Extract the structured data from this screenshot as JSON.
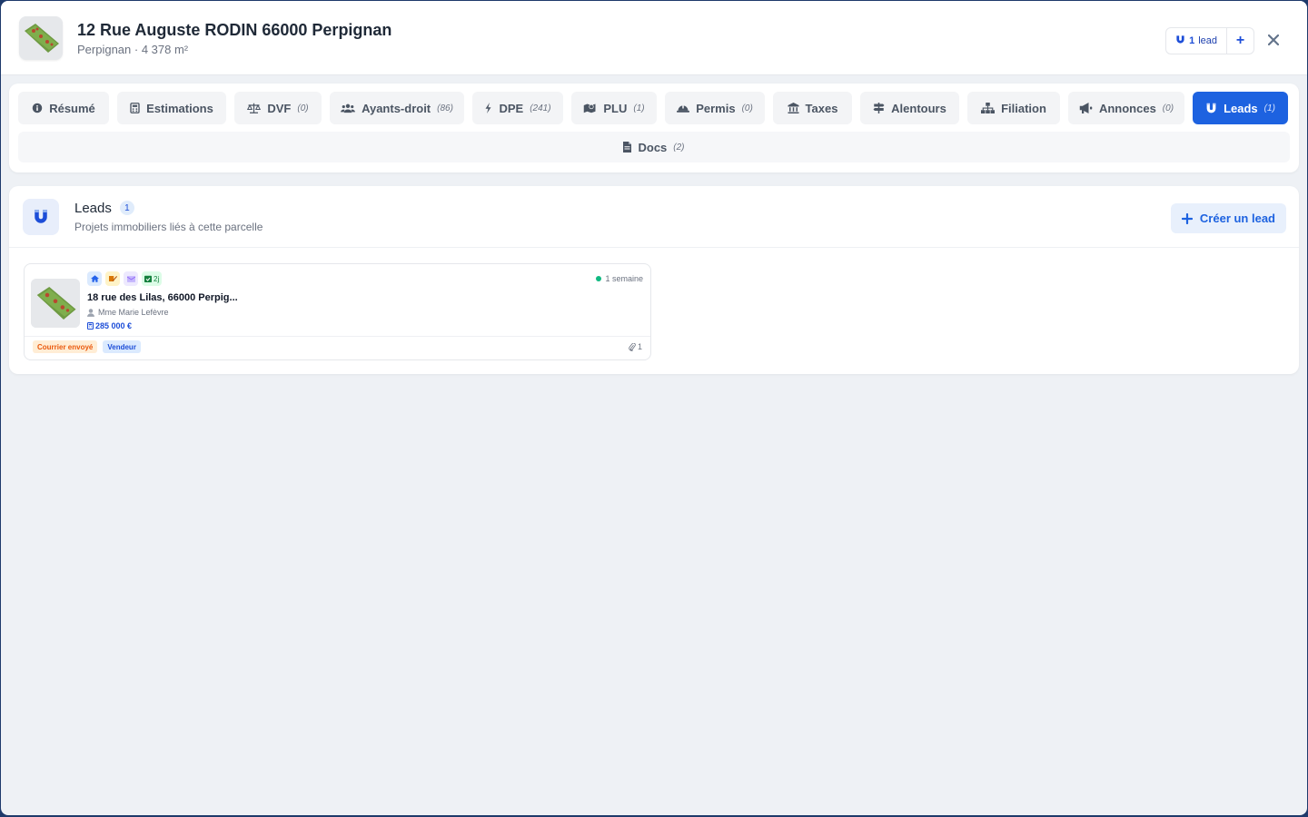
{
  "header": {
    "title": "12 Rue Auguste RODIN 66000 Perpignan",
    "subtitle": "Perpignan · 4 378 m²",
    "lead_count": "1",
    "lead_word": "lead",
    "add_label": "+"
  },
  "tabs": [
    {
      "label": "Résumé",
      "count": "",
      "icon": "info-circle-icon"
    },
    {
      "label": "Estimations",
      "count": "",
      "icon": "calculator-icon"
    },
    {
      "label": "DVF",
      "count": "(0)",
      "icon": "scale-icon"
    },
    {
      "label": "Ayants-droit",
      "count": "(86)",
      "icon": "users-icon"
    },
    {
      "label": "DPE",
      "count": "(241)",
      "icon": "bolt-icon"
    },
    {
      "label": "PLU",
      "count": "(1)",
      "icon": "map-icon"
    },
    {
      "label": "Permis",
      "count": "(0)",
      "icon": "helmet-icon"
    },
    {
      "label": "Taxes",
      "count": "",
      "icon": "bank-icon"
    },
    {
      "label": "Alentours",
      "count": "",
      "icon": "signs-icon"
    },
    {
      "label": "Filiation",
      "count": "",
      "icon": "sitemap-icon"
    },
    {
      "label": "Annonces",
      "count": "(0)",
      "icon": "megaphone-icon"
    },
    {
      "label": "Leads",
      "count": "(1)",
      "icon": "magnet-icon",
      "active": true
    }
  ],
  "docs_tab": {
    "label": "Docs",
    "count": "(2)",
    "icon": "file-icon"
  },
  "leads": {
    "title": "Leads",
    "badge": "1",
    "subtitle": "Projets immobiliers liés à cette parcelle",
    "create_label": "Créer un lead"
  },
  "lead_card": {
    "cal_label": "2j",
    "time": "1 semaine",
    "address": "18 rue des Lilas, 66000 Perpig...",
    "owner": "Mme Marie Lefèvre",
    "price": "285 000 €",
    "tags": [
      "Courrier envoyé",
      "Vendeur"
    ],
    "attachments": "1"
  },
  "colors": {
    "accent": "#1d62e0",
    "status_dot": "#10b981",
    "tag_orange": "#ea580c"
  }
}
